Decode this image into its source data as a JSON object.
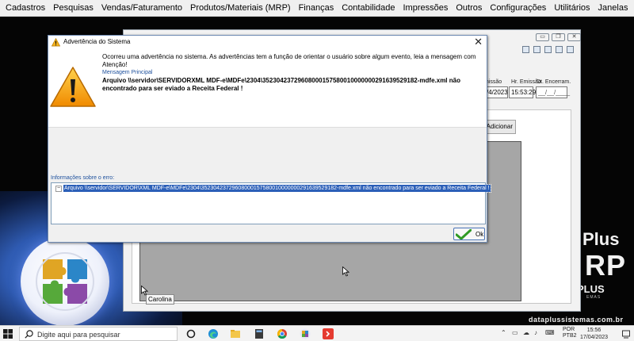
{
  "menu": [
    "Cadastros",
    "Pesquisas",
    "Vendas/Faturamento",
    "Produtos/Materiais (MRP)",
    "Finanças",
    "Contabilidade",
    "Impressões",
    "Outros",
    "Configurações",
    "Utilitários",
    "Janelas"
  ],
  "dialog": {
    "title": "Advertência do Sistema",
    "message": "Ocorreu uma advertência no sistema. As advertências tem a função de orientar o usuário sobre algum evento, leia a mensagem com Atenção!",
    "main_label": "Mensagem Principal",
    "main_message": "Arquivo \\\\servidor\\SERVIDORXML MDF-e\\MDFe\\2304\\35230423729608000157580010000000291639529182-mdfe.xml não encontrado para ser eviado a Receita Federal !",
    "info_label": "Informações sobre o erro:",
    "info_line": "Arquivo \\\\servidor\\SERVIDOR\\XML MDF-e\\MDFe\\2304\\35230423729608000157580010000000291639529182-mdfe.xml não encontrado para ser eviado a Receita Federal !",
    "tree_toggle": "−",
    "ok_label": "Ok"
  },
  "background_window": {
    "col_emissao": "missão",
    "col_hr_emissao": "Hr. Emissão",
    "col_dt_encerram": "Dt. Encerram.",
    "date_value": "/4/2023",
    "time_value": "15:53:29",
    "encerram_value": "__/__/____",
    "add_button": "Adicionar",
    "user_label": "Carolina"
  },
  "branding": {
    "plus": "Plus",
    "rp": "RP",
    "plus_caps": "PLUS",
    "sistemas": "EMAS",
    "site": "dataplussistemas.com.br"
  },
  "taskbar": {
    "search_placeholder": "Digite aqui para pesquisar",
    "lang_line1": "POR",
    "lang_line2": "PTB2",
    "time": "15:56",
    "date": "17/04/2023"
  },
  "colors": {
    "selection": "#2b5fb8",
    "link_label": "#1c4f9c",
    "warning": "#f5a623"
  },
  "icons": {
    "dialog_title": "warning-icon",
    "dialog_big": "warning-icon",
    "ok_button": "check-icon",
    "start": "windows-icon",
    "search": "search-icon"
  }
}
